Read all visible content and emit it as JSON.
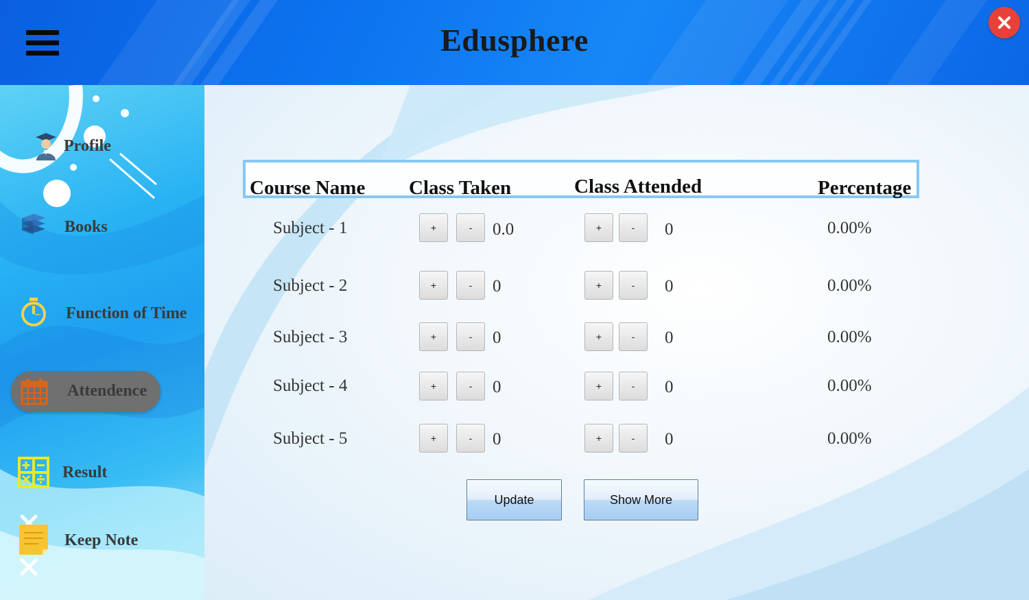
{
  "app": {
    "title": "Edusphere"
  },
  "colors": {
    "header_blue": "#0d74f0",
    "close_red": "#e8413a",
    "active_pill": "#707070",
    "header_border": "#88c8f2"
  },
  "sidebar": {
    "items": [
      {
        "label": "Profile",
        "icon": "graduate-icon"
      },
      {
        "label": "Books",
        "icon": "books-icon"
      },
      {
        "label": "Function of Time",
        "icon": "stopwatch-icon"
      },
      {
        "label": "Attendence",
        "icon": "calendar-icon",
        "active": true
      },
      {
        "label": "Result",
        "icon": "calculator-icon"
      },
      {
        "label": "Keep Note",
        "icon": "sticky-note-icon"
      }
    ]
  },
  "table": {
    "headers": {
      "course": "Course Name",
      "taken": "Class Taken",
      "attended": "Class Attended",
      "percentage": "Percentage"
    },
    "stepper": {
      "plus": "+",
      "minus": "-"
    },
    "rows": [
      {
        "subject": "Subject - 1",
        "taken": "0.0",
        "attended": "0",
        "percentage": "0.00%"
      },
      {
        "subject": "Subject - 2",
        "taken": "0",
        "attended": "0",
        "percentage": "0.00%"
      },
      {
        "subject": "Subject - 3",
        "taken": "0",
        "attended": "0",
        "percentage": "0.00%"
      },
      {
        "subject": "Subject - 4",
        "taken": "0",
        "attended": "0",
        "percentage": "0.00%"
      },
      {
        "subject": "Subject - 5",
        "taken": "0",
        "attended": "0",
        "percentage": "0.00%"
      }
    ]
  },
  "actions": {
    "update": "Update",
    "show_more": "Show More"
  }
}
